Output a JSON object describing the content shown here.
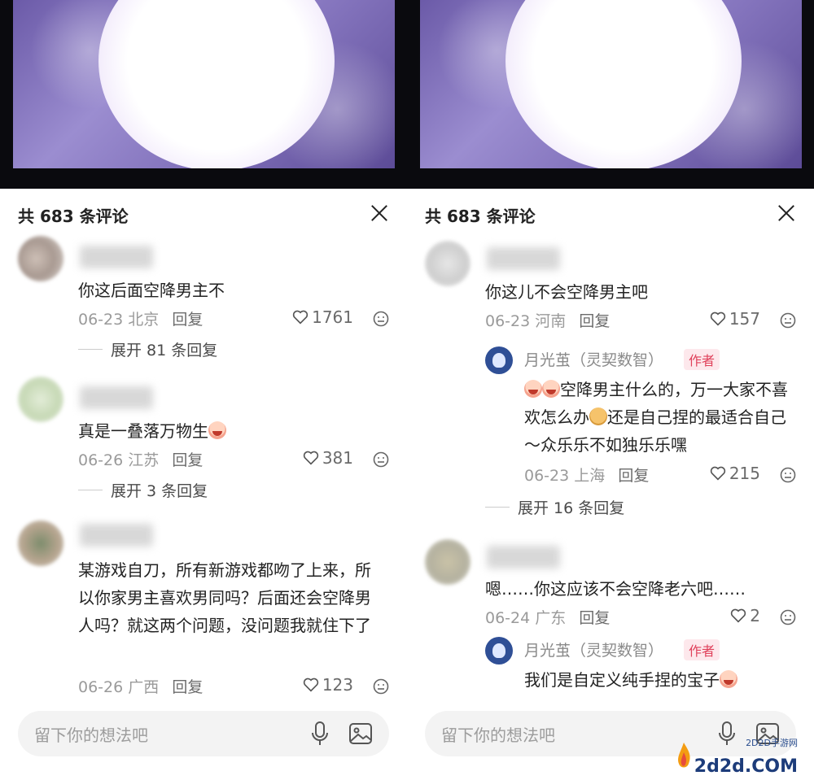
{
  "sheet_title": "共 683 条评论",
  "input_placeholder": "留下你的想法吧",
  "reply_label": "回复",
  "left_comments": [
    {
      "text": "你这后面空降男主不",
      "date": "06-23",
      "location": "北京",
      "likes": "1761",
      "expand": "展开 81 条回复"
    },
    {
      "text": "真是一叠落万物生",
      "date": "06-26",
      "location": "江苏",
      "likes": "381",
      "expand": "展开 3 条回复"
    },
    {
      "text": "某游戏自刀，所有新游戏都吻了上来，所以你家男主喜欢男同吗？后面还会空降男人吗？就这两个问题，没问题我就住下了",
      "date": "06-26",
      "location": "广西",
      "likes": "123"
    }
  ],
  "right_comments": [
    {
      "text": "你这儿不会空降男主吧",
      "date": "06-23",
      "location": "河南",
      "likes": "157"
    },
    {
      "text": "嗯……你这应该不会空降老六吧……",
      "date": "06-24",
      "location": "广东",
      "likes": "2"
    }
  ],
  "author_replies": [
    {
      "name": "月光茧（灵契数智）",
      "tag": "作者",
      "text_a": "空降男主什么的，万一大家不喜欢怎么办",
      "text_b": "还是自己捏的最适合自己～众乐乐不如独乐乐嘿",
      "date": "06-23",
      "location": "上海",
      "likes": "215",
      "expand": "展开 16 条回复"
    },
    {
      "name": "月光茧（灵契数智）",
      "tag": "作者",
      "text": "我们是自定义纯手捏的宝子"
    }
  ],
  "watermark": {
    "sub": "2D2D手游网",
    "main": "2d2d.COM"
  },
  "colors": {
    "accent_red": "#e0405a",
    "banner_purple": "#8474bd"
  },
  "icons": [
    "close-icon",
    "heart-icon",
    "emoji-face-icon",
    "microphone-icon",
    "image-icon",
    "crying-emoji-icon",
    "doge-emoji-icon"
  ]
}
